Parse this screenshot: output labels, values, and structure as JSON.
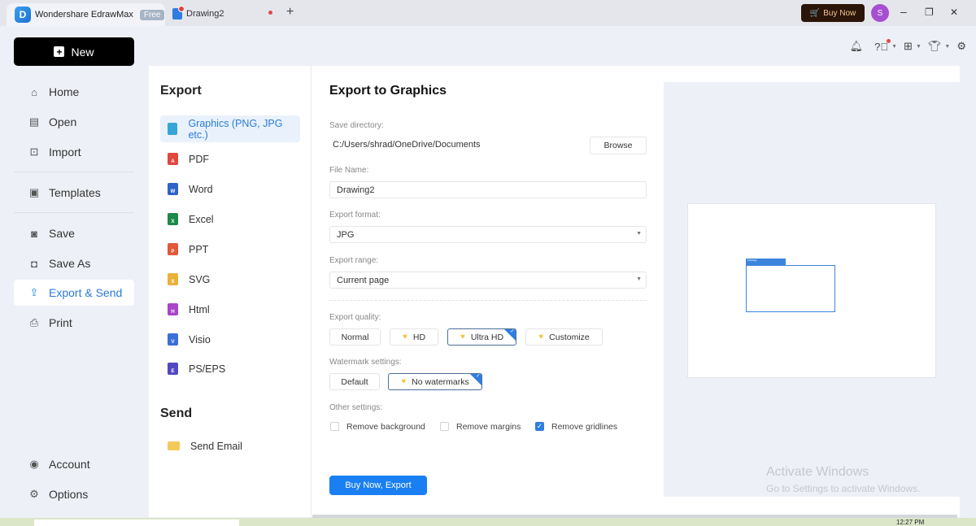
{
  "titlebar": {
    "app_name": "Wondershare EdrawMax",
    "plan_badge": "Free",
    "doc_tab": "Drawing2",
    "new_tab_label": "+",
    "buy_now": "Buy Now",
    "avatar_initial": "S",
    "minimize": "–",
    "restore": "❐",
    "close": "✕"
  },
  "toolbar_icons": [
    "bell-icon",
    "help-icon",
    "apps-icon",
    "theme-icon",
    "settings-icon"
  ],
  "sidebar": {
    "new_label": "New",
    "items": [
      {
        "label": "Home",
        "icon": "home-icon"
      },
      {
        "label": "Open",
        "icon": "open-icon"
      },
      {
        "label": "Import",
        "icon": "import-icon"
      },
      {
        "label": "Templates",
        "icon": "templates-icon"
      },
      {
        "label": "Save",
        "icon": "save-icon"
      },
      {
        "label": "Save As",
        "icon": "save-as-icon"
      },
      {
        "label": "Export & Send",
        "icon": "export-icon",
        "active": true
      },
      {
        "label": "Print",
        "icon": "print-icon"
      }
    ],
    "bottom_items": [
      {
        "label": "Account",
        "icon": "account-icon"
      },
      {
        "label": "Options",
        "icon": "options-icon"
      }
    ]
  },
  "export_nav": {
    "export_title": "Export",
    "formats": [
      {
        "label": "Graphics (PNG, JPG etc.)",
        "color": "#36a6d6",
        "letter": "",
        "active": true
      },
      {
        "label": "PDF",
        "color": "#e0473f",
        "letter": "A"
      },
      {
        "label": "Word",
        "color": "#2f62c8",
        "letter": "W"
      },
      {
        "label": "Excel",
        "color": "#1d8a4a",
        "letter": "X"
      },
      {
        "label": "PPT",
        "color": "#e2583a",
        "letter": "P"
      },
      {
        "label": "SVG",
        "color": "#e9b13a",
        "letter": "S"
      },
      {
        "label": "Html",
        "color": "#a845c9",
        "letter": "H"
      },
      {
        "label": "Visio",
        "color": "#3b6fd8",
        "letter": "V"
      },
      {
        "label": "PS/EPS",
        "color": "#5148c2",
        "letter": "E"
      }
    ],
    "send_title": "Send",
    "send_items": [
      {
        "label": "Send Email",
        "color": "#f4c95a"
      }
    ]
  },
  "form": {
    "title": "Export to Graphics",
    "save_directory_label": "Save directory:",
    "save_directory_value": "C:/Users/shrad/OneDrive/Documents",
    "browse_label": "Browse",
    "file_name_label": "File Name:",
    "file_name_value": "Drawing2",
    "export_format_label": "Export format:",
    "export_format_value": "JPG",
    "export_range_label": "Export range:",
    "export_range_value": "Current page",
    "quality_label": "Export quality:",
    "quality_options": [
      {
        "label": "Normal",
        "premium": false,
        "selected": false
      },
      {
        "label": "HD",
        "premium": true,
        "selected": false
      },
      {
        "label": "Ultra HD",
        "premium": true,
        "selected": true
      },
      {
        "label": "Customize",
        "premium": true,
        "selected": false
      }
    ],
    "watermark_label": "Watermark settings:",
    "watermark_options": [
      {
        "label": "Default",
        "premium": false,
        "selected": false
      },
      {
        "label": "No watermarks",
        "premium": true,
        "selected": true
      }
    ],
    "other_label": "Other settings:",
    "other_options": [
      {
        "label": "Remove background",
        "checked": false
      },
      {
        "label": "Remove margins",
        "checked": false
      },
      {
        "label": "Remove gridlines",
        "checked": true
      }
    ],
    "export_button": "Buy Now, Export"
  },
  "preview": {
    "shape_label": "Package"
  },
  "watermark": {
    "line1": "Activate Windows",
    "line2": "Go to Settings to activate Windows."
  },
  "taskbar": {
    "clock": "12:27 PM"
  }
}
